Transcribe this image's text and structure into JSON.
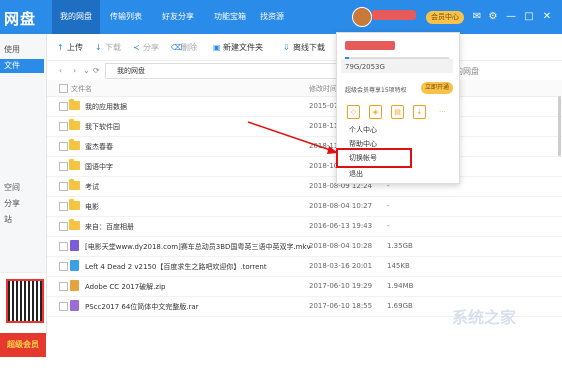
{
  "app": {
    "logo": "网盘",
    "tabs": [
      "我的网盘",
      "传输列表",
      "好友分享",
      "功能宝箱",
      "找资源"
    ],
    "vip_center": "会员中心"
  },
  "sidebar": {
    "items": [
      "使用",
      "文件",
      "空间",
      "分享",
      "站"
    ],
    "promo_text": "超级会员"
  },
  "toolbar": {
    "upload": "上传",
    "download": "下载",
    "share": "分享",
    "delete": "删除",
    "new_folder": "新建文件夹",
    "offline": "离线下载"
  },
  "pathbar": {
    "path": "我的网盘",
    "search_hint": "的网盘"
  },
  "table": {
    "col_name": "文件名",
    "col_modified": "修改时间",
    "rows": [
      {
        "name": "我的应用数据",
        "date": "2015-07-2",
        "size": "",
        "type": "folder"
      },
      {
        "name": "我下软件园",
        "date": "2018-11-3",
        "size": "",
        "type": "folder"
      },
      {
        "name": "蜜杰春春",
        "date": "2018-11-0",
        "size": "",
        "type": "folder"
      },
      {
        "name": "国语中字",
        "date": "2018-10-2",
        "size": "",
        "type": "folder"
      },
      {
        "name": "考试",
        "date": "2018-08-09 12:24",
        "size": "-",
        "type": "folder"
      },
      {
        "name": "电影",
        "date": "2018-08-04 10:27",
        "size": "-",
        "type": "folder"
      },
      {
        "name": "来自：百度相册",
        "date": "2016-06-13 19:43",
        "size": "-",
        "type": "folder"
      },
      {
        "name": "[电影天堂www.dy2018.com]赛车总动员3BD国粤英三语中英双字.mkv",
        "date": "2018-08-04 10:28",
        "size": "1.35GB",
        "type": "video"
      },
      {
        "name": "Left 4 Dead 2 v2150【百度求生之路吧欢迎你】.torrent",
        "date": "2018-03-16 20:01",
        "size": "145KB",
        "type": "torrent"
      },
      {
        "name": "Adobe CC 2017破解.zip",
        "date": "2017-06-10 19:29",
        "size": "1.94MB",
        "type": "zip"
      },
      {
        "name": "PScc2017 64位简体中文完整版.rar",
        "date": "2017-06-10 18:55",
        "size": "1.69GB",
        "type": "rar"
      }
    ]
  },
  "dropdown": {
    "quota": "79G/2053G",
    "quota_fraction": 0.04,
    "vip_text": "超级会员尊享15项特权",
    "open_button": "立即开通",
    "menu": [
      "个人中心",
      "帮助中心",
      "切换帐号",
      "退出"
    ],
    "more": "..."
  },
  "colors": {
    "brand": "#2b8be8",
    "highlight": "#e01010",
    "vip": "#f7c14a"
  },
  "watermark": "系统之家"
}
